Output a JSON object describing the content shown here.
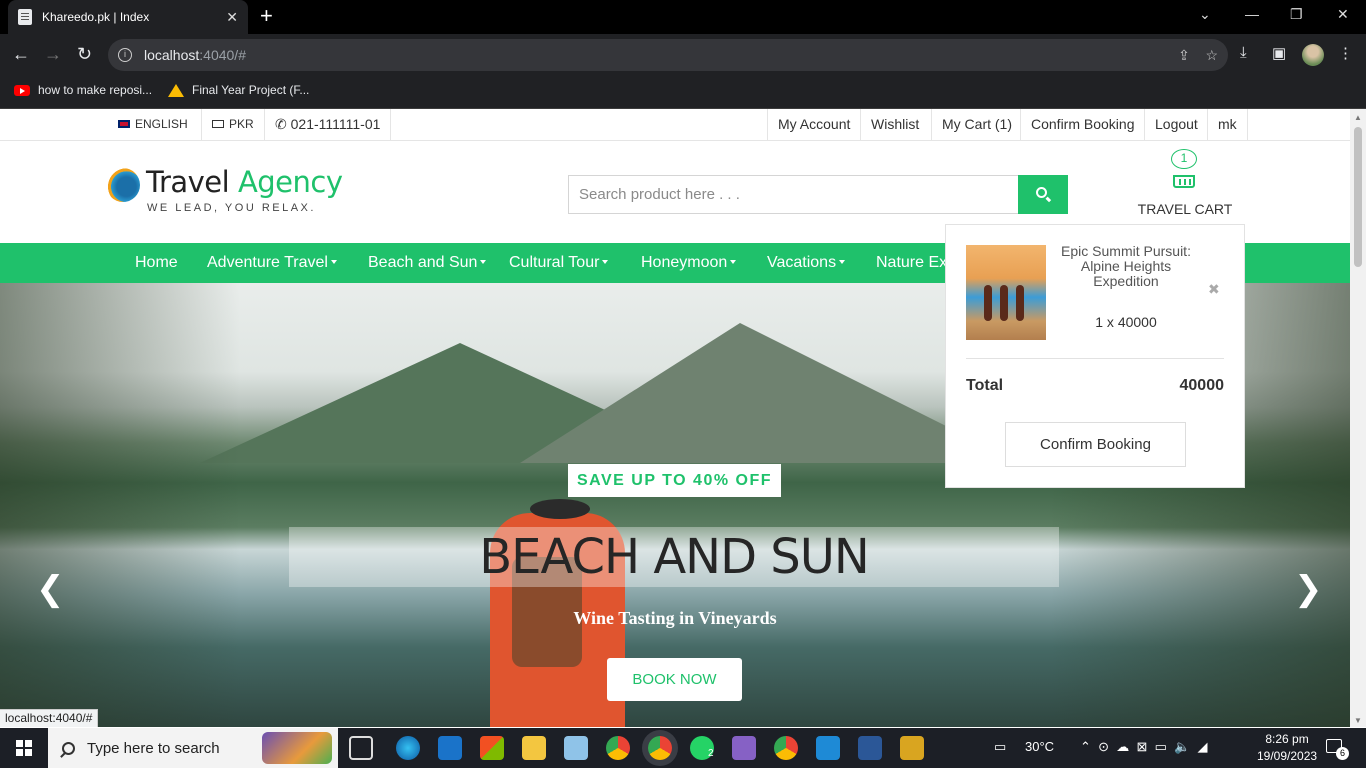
{
  "browser": {
    "tab_title": "Khareedo.pk | Index",
    "tab_close": "✕",
    "new_tab": "+",
    "url_host": "localhost",
    "url_path": ":4040/#",
    "bookmarks": [
      "how to make reposi...",
      "Final Year Project (F..."
    ],
    "status_url": "localhost:4040/#"
  },
  "topbar": {
    "language": "ENGLISH",
    "currency": "PKR",
    "phone": "021-111111-01",
    "links": [
      "My Account",
      "Wishlist",
      "My Cart (1)",
      "Confirm Booking",
      "Logout",
      "mk"
    ]
  },
  "header": {
    "logo_word1": "Travel",
    "logo_word2": "Agency",
    "tagline": "WE LEAD, YOU RELAX.",
    "search_placeholder": "Search product here . . .",
    "cart_count": "1",
    "cart_label": "TRAVEL CART"
  },
  "nav": {
    "items": [
      {
        "label": "Home",
        "has_dropdown": false
      },
      {
        "label": "Adventure Travel",
        "has_dropdown": true
      },
      {
        "label": "Beach and Sun",
        "has_dropdown": true
      },
      {
        "label": "Cultural Tour",
        "has_dropdown": true
      },
      {
        "label": "Honeymoon",
        "has_dropdown": true
      },
      {
        "label": "Vacations",
        "has_dropdown": true
      },
      {
        "label": "Nature Ex",
        "has_dropdown": false
      }
    ],
    "color": "#1fc16b"
  },
  "hero": {
    "badge": "SAVE UP TO 40% OFF",
    "headline": "BEACH AND SUN",
    "subtitle": "Wine Tasting in Vineyards",
    "cta": "BOOK NOW",
    "prev": "❮",
    "next": "❯"
  },
  "cart_dropdown": {
    "item_name": "Epic Summit Pursuit: Alpine Heights Expedition",
    "item_qty": "1 x 40000",
    "remove": "✖",
    "total_label": "Total",
    "total_value": "40000",
    "confirm_button": "Confirm Booking"
  },
  "taskbar": {
    "search_text": "Type here to search",
    "temperature": "30°C",
    "time": "8:26 pm",
    "date": "19/09/2023",
    "notification_count": "6",
    "whatsapp_badge": "2"
  }
}
